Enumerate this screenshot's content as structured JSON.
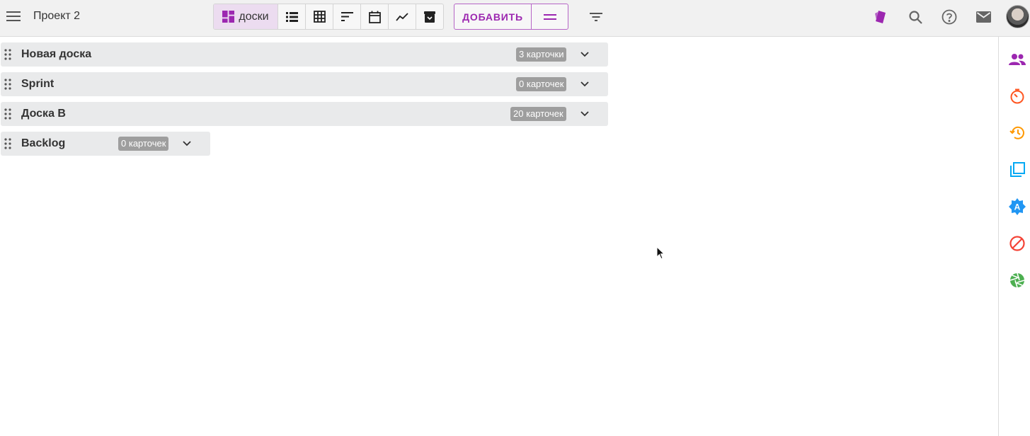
{
  "header": {
    "project_title": "Проект 2",
    "views": {
      "active_label": "доски",
      "items": [
        "boards-view",
        "list-view",
        "table-view",
        "sort-view",
        "calendar-view",
        "chart-view",
        "archive-view"
      ]
    },
    "add_label": "ДОБАВИТЬ",
    "right_icons": [
      "cards-icon",
      "search-icon",
      "help-icon",
      "mail-icon",
      "avatar"
    ]
  },
  "boards": [
    {
      "name": "Новая доска",
      "count": "3 карточки"
    },
    {
      "name": "Sprint",
      "count": "0 карточек"
    },
    {
      "name": "Доска B",
      "count": "20 карточек"
    },
    {
      "name": "Backlog",
      "count": "0 карточек"
    }
  ],
  "rail": [
    "people-icon",
    "timer-icon",
    "history-icon",
    "layers-icon",
    "badge-a-icon",
    "block-icon",
    "aperture-icon"
  ],
  "colors": {
    "accent": "#9c27b0",
    "rail_people": "#9c27b0",
    "rail_timer": "#ff5722",
    "rail_history": "#ff9800",
    "rail_layers": "#03a9f4",
    "rail_badge": "#2196f3",
    "rail_block": "#f44336",
    "rail_aperture": "#4caf50"
  }
}
